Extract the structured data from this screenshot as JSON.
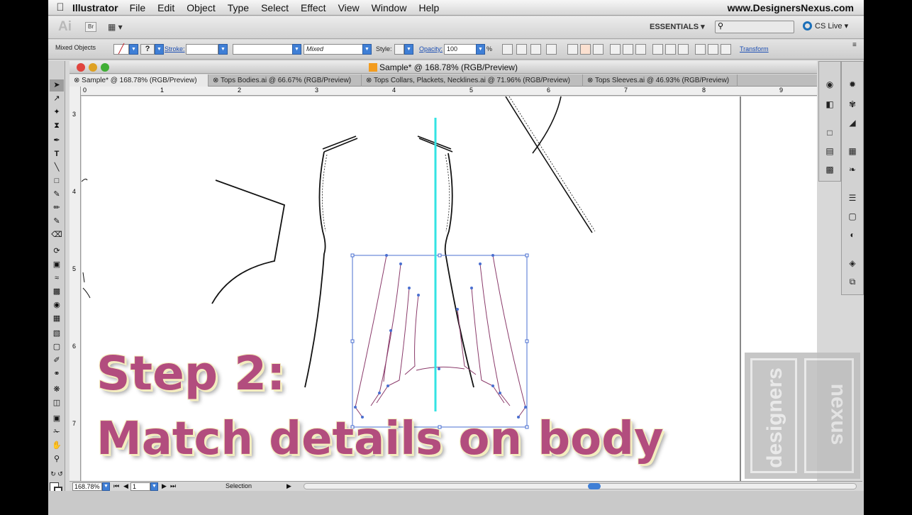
{
  "menubar": {
    "apple": "",
    "app_name": "Illustrator",
    "items": [
      "File",
      "Edit",
      "Object",
      "Type",
      "Select",
      "Effect",
      "View",
      "Window",
      "Help"
    ],
    "site": "www.DesignersNexus.com"
  },
  "appbar": {
    "logo": "Ai",
    "bridge": "Br",
    "workspace": "ESSENTIALS ▾",
    "search_placeholder": "",
    "cs_live": "CS Live ▾"
  },
  "controlbar": {
    "selection_label": "Mixed Objects",
    "stroke_label": "Stroke:",
    "brush_value": "Mixed",
    "style_label": "Style:",
    "opacity_label": "Opacity:",
    "opacity_value": "100",
    "percent": "%",
    "transform_link": "Transform"
  },
  "document": {
    "window_title": "Sample* @ 168.78% (RGB/Preview)",
    "tabs": [
      {
        "label": "Sample* @ 168.78% (RGB/Preview)",
        "active": true
      },
      {
        "label": "Tops Bodies.ai @ 66.67% (RGB/Preview)",
        "active": false
      },
      {
        "label": "Tops Collars, Plackets, Necklines.ai @ 71.96% (RGB/Preview)",
        "active": false
      },
      {
        "label": "Tops Sleeves.ai @ 46.93% (RGB/Preview)",
        "active": false
      }
    ],
    "ruler_h": [
      "0",
      "1",
      "2",
      "3",
      "4",
      "5",
      "6",
      "7",
      "8",
      "9"
    ],
    "ruler_v": [
      "3",
      "4",
      "5",
      "6",
      "7"
    ]
  },
  "statusbar": {
    "zoom": "168.78%",
    "page": "1",
    "tool_name": "Selection"
  },
  "caption": {
    "line1": "Step 2:",
    "line2": "Match details on body"
  },
  "watermark": {
    "text1": "designers",
    "text2": "nexus"
  },
  "colors": {
    "caption_fill": "#b24d7e",
    "caption_outline": "#f4edc0",
    "center_line": "#33e3e3",
    "selection": "#4a6fd0"
  }
}
